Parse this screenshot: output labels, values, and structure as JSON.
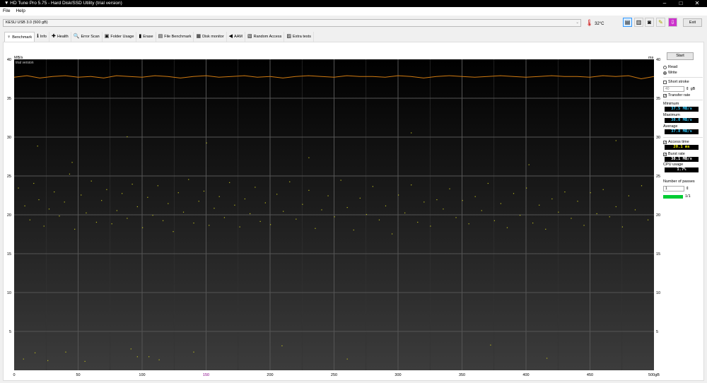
{
  "window": {
    "title": "HD Tune Pro 5.75 - Hard Disk/SSD Utility (trial version)",
    "minimize": "–",
    "maximize": "□",
    "close": "✕"
  },
  "menu": [
    "File",
    "Help"
  ],
  "drive": {
    "selected": "KESU    USB 3.0 (500 gB)"
  },
  "temperature": "32°C",
  "toolbar": {
    "exit": "Exit",
    "icons": [
      "copy-text-icon",
      "copy-image-icon",
      "screenshot-icon",
      "options-icon",
      "download-icon"
    ]
  },
  "tabs": [
    {
      "label": "Benchmark",
      "icon": "benchmark-icon",
      "glyph": "♀"
    },
    {
      "label": "Info",
      "icon": "info-icon",
      "glyph": "ℹ"
    },
    {
      "label": "Health",
      "icon": "health-icon",
      "glyph": "✚"
    },
    {
      "label": "Error Scan",
      "icon": "error-scan-icon",
      "glyph": "🔍"
    },
    {
      "label": "Folder Usage",
      "icon": "folder-icon",
      "glyph": "▣"
    },
    {
      "label": "Erase",
      "icon": "erase-icon",
      "glyph": "▮"
    },
    {
      "label": "File Benchmark",
      "icon": "file-benchmark-icon",
      "glyph": "▤"
    },
    {
      "label": "Disk monitor",
      "icon": "disk-monitor-icon",
      "glyph": "▦"
    },
    {
      "label": "AAM",
      "icon": "aam-icon",
      "glyph": "◀"
    },
    {
      "label": "Random Access",
      "icon": "random-access-icon",
      "glyph": "▧"
    },
    {
      "label": "Extra tests",
      "icon": "extra-tests-icon",
      "glyph": "▨"
    }
  ],
  "panel": {
    "start": "Start",
    "read": "Read",
    "write": "Write",
    "mode": "write",
    "short_stroke": "Short stroke",
    "short_stroke_checked": false,
    "short_stroke_value": "40",
    "short_stroke_unit": "gB",
    "transfer_rate": "Transfer rate",
    "minimum_label": "Minimum",
    "minimum": "37.5 MB/s",
    "maximum_label": "Maximum",
    "maximum": "38.0 MB/s",
    "average_label": "Average",
    "average": "37.8 MB/s",
    "access_time": "Access time",
    "access_time_value": "20.1 ms",
    "burst_rate": "Burst rate",
    "burst_rate_value": "38.1 MB/s",
    "cpu_label": "CPU usage",
    "cpu": "1.7%",
    "passes_label": "Number of passes",
    "passes": "1",
    "progress": "1/1",
    "progress_fraction": 1.0
  },
  "chart_data": {
    "type": "line+scatter",
    "watermark": "trial version",
    "left_unit": "MB/s",
    "right_unit": "ms",
    "x_unit": "gB",
    "ylim": [
      0,
      40
    ],
    "y2lim": [
      0,
      40
    ],
    "xlim": [
      0,
      500
    ],
    "yticks": [
      "5",
      "10",
      "15",
      "20",
      "25",
      "30",
      "35",
      "40"
    ],
    "xticks": [
      "0",
      "50",
      "100",
      "150",
      "200",
      "250",
      "300",
      "350",
      "400",
      "450",
      "500gB"
    ],
    "grid": true,
    "colors": {
      "transfer": "#d07a10",
      "access": "#b8b820"
    },
    "transfer_rate": {
      "x": [
        0,
        10,
        20,
        30,
        40,
        50,
        60,
        70,
        80,
        90,
        100,
        110,
        120,
        130,
        140,
        150,
        160,
        170,
        180,
        190,
        200,
        210,
        220,
        230,
        240,
        250,
        260,
        270,
        280,
        290,
        300,
        310,
        320,
        330,
        340,
        350,
        360,
        370,
        380,
        390,
        400,
        410,
        420,
        430,
        440,
        450,
        460,
        470,
        480,
        490,
        500
      ],
      "y": [
        37.7,
        37.9,
        37.6,
        37.8,
        37.9,
        37.7,
        37.8,
        37.6,
        37.9,
        37.8,
        37.7,
        37.9,
        37.8,
        37.6,
        37.8,
        37.9,
        37.7,
        37.8,
        37.9,
        37.7,
        37.8,
        37.6,
        37.8,
        37.9,
        37.8,
        37.7,
        37.9,
        37.8,
        37.8,
        37.7,
        37.9,
        37.8,
        37.6,
        37.8,
        37.9,
        37.8,
        37.7,
        37.8,
        37.9,
        37.8,
        37.7,
        37.8,
        37.9,
        37.8,
        37.8,
        37.7,
        37.9,
        37.8,
        37.9,
        37.5,
        37.8
      ]
    },
    "access_time": [
      [
        3,
        23.5
      ],
      [
        8,
        21.2
      ],
      [
        12,
        19.4
      ],
      [
        15,
        24.1
      ],
      [
        19,
        22.0
      ],
      [
        23,
        18.6
      ],
      [
        27,
        20.8
      ],
      [
        31,
        23.0
      ],
      [
        35,
        19.9
      ],
      [
        39,
        21.7
      ],
      [
        43,
        25.3
      ],
      [
        47,
        18.2
      ],
      [
        52,
        22.6
      ],
      [
        56,
        20.3
      ],
      [
        60,
        24.4
      ],
      [
        64,
        19.1
      ],
      [
        68,
        21.9
      ],
      [
        72,
        23.3
      ],
      [
        76,
        18.9
      ],
      [
        80,
        20.6
      ],
      [
        84,
        22.8
      ],
      [
        88,
        19.6
      ],
      [
        92,
        24.0
      ],
      [
        96,
        21.1
      ],
      [
        100,
        18.4
      ],
      [
        104,
        22.3
      ],
      [
        108,
        20.0
      ],
      [
        112,
        23.8
      ],
      [
        116,
        19.3
      ],
      [
        120,
        21.5
      ],
      [
        124,
        17.9
      ],
      [
        128,
        22.9
      ],
      [
        132,
        20.4
      ],
      [
        136,
        24.6
      ],
      [
        140,
        19.0
      ],
      [
        144,
        21.8
      ],
      [
        148,
        23.1
      ],
      [
        152,
        18.7
      ],
      [
        156,
        20.9
      ],
      [
        160,
        22.4
      ],
      [
        164,
        19.7
      ],
      [
        168,
        24.2
      ],
      [
        172,
        21.3
      ],
      [
        176,
        18.5
      ],
      [
        180,
        22.1
      ],
      [
        184,
        20.2
      ],
      [
        188,
        23.6
      ],
      [
        192,
        19.2
      ],
      [
        196,
        21.6
      ],
      [
        200,
        18.8
      ],
      [
        205,
        22.7
      ],
      [
        210,
        20.5
      ],
      [
        215,
        24.3
      ],
      [
        220,
        19.5
      ],
      [
        225,
        21.4
      ],
      [
        230,
        23.2
      ],
      [
        235,
        18.3
      ],
      [
        240,
        20.7
      ],
      [
        245,
        22.5
      ],
      [
        250,
        19.8
      ],
      [
        255,
        24.5
      ],
      [
        260,
        21.0
      ],
      [
        265,
        18.1
      ],
      [
        270,
        22.2
      ],
      [
        275,
        20.1
      ],
      [
        280,
        23.7
      ],
      [
        285,
        19.4
      ],
      [
        290,
        21.2
      ],
      [
        295,
        17.6
      ],
      [
        300,
        22.6
      ],
      [
        305,
        20.3
      ],
      [
        310,
        23.9
      ],
      [
        315,
        19.1
      ],
      [
        320,
        21.7
      ],
      [
        325,
        18.6
      ],
      [
        330,
        22.0
      ],
      [
        335,
        20.8
      ],
      [
        340,
        23.4
      ],
      [
        345,
        19.7
      ],
      [
        350,
        21.9
      ],
      [
        355,
        18.9
      ],
      [
        360,
        22.4
      ],
      [
        365,
        20.6
      ],
      [
        370,
        24.1
      ],
      [
        375,
        19.3
      ],
      [
        380,
        21.5
      ],
      [
        385,
        18.4
      ],
      [
        390,
        22.8
      ],
      [
        395,
        20.0
      ],
      [
        400,
        23.5
      ],
      [
        405,
        19.0
      ],
      [
        410,
        21.3
      ],
      [
        415,
        18.2
      ],
      [
        420,
        22.1
      ],
      [
        425,
        20.4
      ],
      [
        430,
        23.0
      ],
      [
        435,
        19.6
      ],
      [
        440,
        21.8
      ],
      [
        445,
        18.7
      ],
      [
        450,
        22.9
      ],
      [
        455,
        20.2
      ],
      [
        460,
        23.3
      ],
      [
        465,
        19.8
      ],
      [
        470,
        21.1
      ],
      [
        475,
        18.5
      ],
      [
        480,
        22.5
      ],
      [
        485,
        20.7
      ],
      [
        490,
        23.8
      ],
      [
        495,
        19.4
      ],
      [
        7,
        1.5
      ],
      [
        16,
        2.3
      ],
      [
        26,
        1.3
      ],
      [
        40,
        2.4
      ],
      [
        55,
        1.2
      ],
      [
        91,
        2.8
      ],
      [
        96,
        1.8
      ],
      [
        105,
        1.8
      ],
      [
        113,
        1.4
      ],
      [
        140,
        2.4
      ],
      [
        209,
        3.2
      ],
      [
        260,
        1.5
      ],
      [
        372,
        3.3
      ],
      [
        416,
        1.6
      ],
      [
        18,
        28.9
      ],
      [
        45,
        26.8
      ],
      [
        88,
        30.1
      ],
      [
        150,
        29.3
      ],
      [
        230,
        27.4
      ],
      [
        310,
        30.6
      ],
      [
        402,
        26.5
      ],
      [
        470,
        29.6
      ]
    ]
  }
}
